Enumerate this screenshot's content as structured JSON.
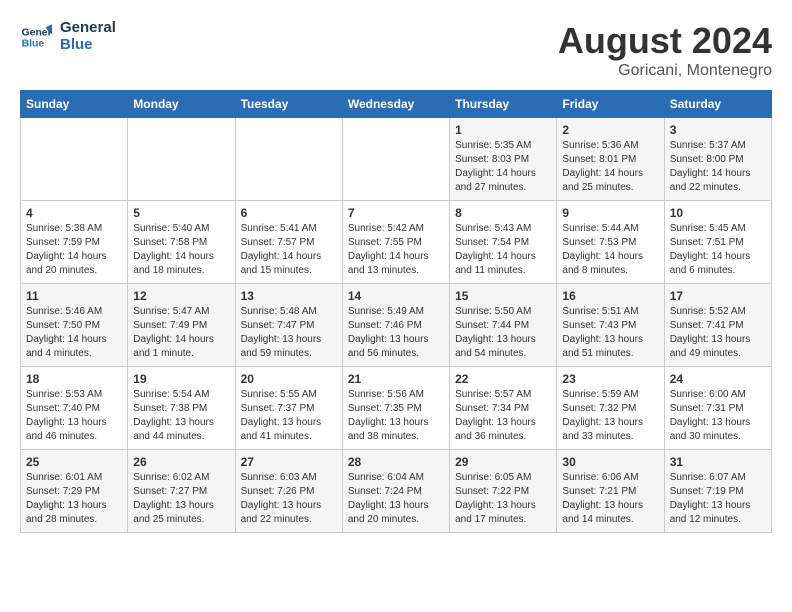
{
  "header": {
    "logo_line1": "General",
    "logo_line2": "Blue",
    "title": "August 2024",
    "subtitle": "Goricani, Montenegro"
  },
  "calendar": {
    "days_of_week": [
      "Sunday",
      "Monday",
      "Tuesday",
      "Wednesday",
      "Thursday",
      "Friday",
      "Saturday"
    ],
    "weeks": [
      [
        {
          "day": "",
          "detail": ""
        },
        {
          "day": "",
          "detail": ""
        },
        {
          "day": "",
          "detail": ""
        },
        {
          "day": "",
          "detail": ""
        },
        {
          "day": "1",
          "detail": "Sunrise: 5:35 AM\nSunset: 8:03 PM\nDaylight: 14 hours\nand 27 minutes."
        },
        {
          "day": "2",
          "detail": "Sunrise: 5:36 AM\nSunset: 8:01 PM\nDaylight: 14 hours\nand 25 minutes."
        },
        {
          "day": "3",
          "detail": "Sunrise: 5:37 AM\nSunset: 8:00 PM\nDaylight: 14 hours\nand 22 minutes."
        }
      ],
      [
        {
          "day": "4",
          "detail": "Sunrise: 5:38 AM\nSunset: 7:59 PM\nDaylight: 14 hours\nand 20 minutes."
        },
        {
          "day": "5",
          "detail": "Sunrise: 5:40 AM\nSunset: 7:58 PM\nDaylight: 14 hours\nand 18 minutes."
        },
        {
          "day": "6",
          "detail": "Sunrise: 5:41 AM\nSunset: 7:57 PM\nDaylight: 14 hours\nand 15 minutes."
        },
        {
          "day": "7",
          "detail": "Sunrise: 5:42 AM\nSunset: 7:55 PM\nDaylight: 14 hours\nand 13 minutes."
        },
        {
          "day": "8",
          "detail": "Sunrise: 5:43 AM\nSunset: 7:54 PM\nDaylight: 14 hours\nand 11 minutes."
        },
        {
          "day": "9",
          "detail": "Sunrise: 5:44 AM\nSunset: 7:53 PM\nDaylight: 14 hours\nand 8 minutes."
        },
        {
          "day": "10",
          "detail": "Sunrise: 5:45 AM\nSunset: 7:51 PM\nDaylight: 14 hours\nand 6 minutes."
        }
      ],
      [
        {
          "day": "11",
          "detail": "Sunrise: 5:46 AM\nSunset: 7:50 PM\nDaylight: 14 hours\nand 4 minutes."
        },
        {
          "day": "12",
          "detail": "Sunrise: 5:47 AM\nSunset: 7:49 PM\nDaylight: 14 hours\nand 1 minute."
        },
        {
          "day": "13",
          "detail": "Sunrise: 5:48 AM\nSunset: 7:47 PM\nDaylight: 13 hours\nand 59 minutes."
        },
        {
          "day": "14",
          "detail": "Sunrise: 5:49 AM\nSunset: 7:46 PM\nDaylight: 13 hours\nand 56 minutes."
        },
        {
          "day": "15",
          "detail": "Sunrise: 5:50 AM\nSunset: 7:44 PM\nDaylight: 13 hours\nand 54 minutes."
        },
        {
          "day": "16",
          "detail": "Sunrise: 5:51 AM\nSunset: 7:43 PM\nDaylight: 13 hours\nand 51 minutes."
        },
        {
          "day": "17",
          "detail": "Sunrise: 5:52 AM\nSunset: 7:41 PM\nDaylight: 13 hours\nand 49 minutes."
        }
      ],
      [
        {
          "day": "18",
          "detail": "Sunrise: 5:53 AM\nSunset: 7:40 PM\nDaylight: 13 hours\nand 46 minutes."
        },
        {
          "day": "19",
          "detail": "Sunrise: 5:54 AM\nSunset: 7:38 PM\nDaylight: 13 hours\nand 44 minutes."
        },
        {
          "day": "20",
          "detail": "Sunrise: 5:55 AM\nSunset: 7:37 PM\nDaylight: 13 hours\nand 41 minutes."
        },
        {
          "day": "21",
          "detail": "Sunrise: 5:56 AM\nSunset: 7:35 PM\nDaylight: 13 hours\nand 38 minutes."
        },
        {
          "day": "22",
          "detail": "Sunrise: 5:57 AM\nSunset: 7:34 PM\nDaylight: 13 hours\nand 36 minutes."
        },
        {
          "day": "23",
          "detail": "Sunrise: 5:59 AM\nSunset: 7:32 PM\nDaylight: 13 hours\nand 33 minutes."
        },
        {
          "day": "24",
          "detail": "Sunrise: 6:00 AM\nSunset: 7:31 PM\nDaylight: 13 hours\nand 30 minutes."
        }
      ],
      [
        {
          "day": "25",
          "detail": "Sunrise: 6:01 AM\nSunset: 7:29 PM\nDaylight: 13 hours\nand 28 minutes."
        },
        {
          "day": "26",
          "detail": "Sunrise: 6:02 AM\nSunset: 7:27 PM\nDaylight: 13 hours\nand 25 minutes."
        },
        {
          "day": "27",
          "detail": "Sunrise: 6:03 AM\nSunset: 7:26 PM\nDaylight: 13 hours\nand 22 minutes."
        },
        {
          "day": "28",
          "detail": "Sunrise: 6:04 AM\nSunset: 7:24 PM\nDaylight: 13 hours\nand 20 minutes."
        },
        {
          "day": "29",
          "detail": "Sunrise: 6:05 AM\nSunset: 7:22 PM\nDaylight: 13 hours\nand 17 minutes."
        },
        {
          "day": "30",
          "detail": "Sunrise: 6:06 AM\nSunset: 7:21 PM\nDaylight: 13 hours\nand 14 minutes."
        },
        {
          "day": "31",
          "detail": "Sunrise: 6:07 AM\nSunset: 7:19 PM\nDaylight: 13 hours\nand 12 minutes."
        }
      ]
    ]
  }
}
